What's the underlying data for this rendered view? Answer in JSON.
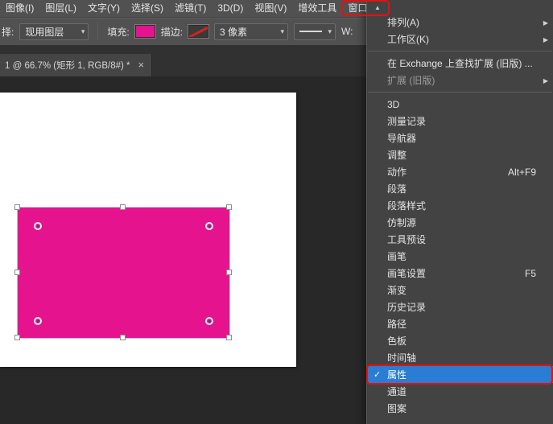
{
  "icons": {
    "dropdown_arrow": "▾",
    "close": "×",
    "submenu_arrow": "▶",
    "check": "✓",
    "scroll_up": "▲"
  },
  "colors": {
    "shape_fill": "#e5148e",
    "menu_highlight_blue": "#2b7cd3",
    "annotation_red": "#e21212",
    "ui_background": "#515151",
    "pasteboard": "#282828"
  },
  "menubar": {
    "items": [
      "图像(I)",
      "图层(L)",
      "文字(Y)",
      "选择(S)",
      "滤镜(T)",
      "3D(D)",
      "视图(V)",
      "增效工具",
      "窗口(W)"
    ]
  },
  "options_bar": {
    "select_label": "择:",
    "select_value": "现用图层",
    "fill_label": "填充:",
    "stroke_label": "描边:",
    "stroke_width_value": "3 像素",
    "width_label": "W:"
  },
  "document_tab": {
    "title": "1 @ 66.7% (矩形 1, RGB/8#) *"
  },
  "window_menu": {
    "items": [
      {
        "label": "排列(A)",
        "submenu": true
      },
      {
        "label": "工作区(K)",
        "submenu": true
      },
      {
        "label": "在 Exchange 上查找扩展 (旧版) ..."
      },
      {
        "label": "扩展 (旧版)",
        "submenu": true,
        "disabled": true
      },
      {
        "label": "3D"
      },
      {
        "label": "测量记录"
      },
      {
        "label": "导航器"
      },
      {
        "label": "调整"
      },
      {
        "label": "动作",
        "shortcut": "Alt+F9"
      },
      {
        "label": "段落"
      },
      {
        "label": "段落样式"
      },
      {
        "label": "仿制源"
      },
      {
        "label": "工具预设"
      },
      {
        "label": "画笔"
      },
      {
        "label": "画笔设置",
        "shortcut": "F5"
      },
      {
        "label": "渐变"
      },
      {
        "label": "历史记录"
      },
      {
        "label": "路径"
      },
      {
        "label": "色板"
      },
      {
        "label": "时间轴"
      },
      {
        "label": "属性",
        "checked": true,
        "selected": true
      },
      {
        "label": "通道"
      },
      {
        "label": "图案"
      }
    ]
  }
}
